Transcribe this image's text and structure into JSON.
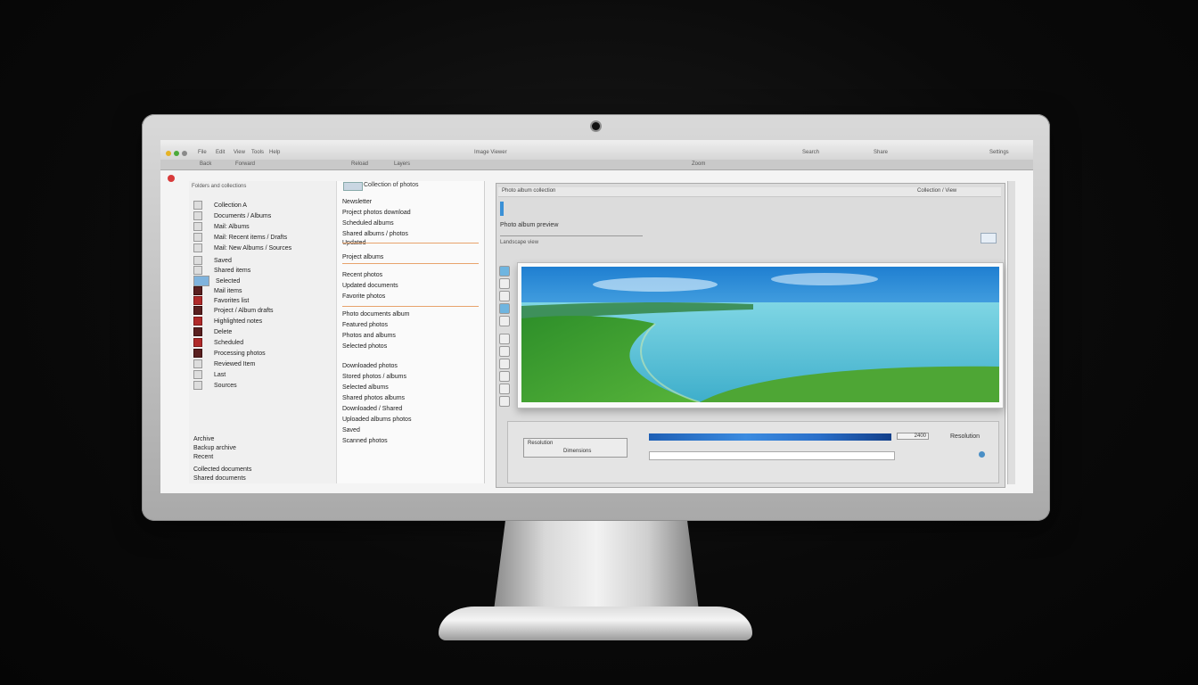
{
  "topbar": {
    "tabs": [
      "File",
      "Edit",
      "View",
      "Tools",
      "Help"
    ],
    "center_text": "Image Viewer",
    "right_items": [
      "Search",
      "Share",
      "Settings"
    ]
  },
  "toolbar": {
    "items": [
      "Back",
      "Forward",
      "Reload",
      "Layers",
      "Zoom"
    ]
  },
  "sidebar": {
    "header": "Folders and collections",
    "items": [
      {
        "label": "Collection A",
        "icon": "folder-icon"
      },
      {
        "label": "Documents / Albums",
        "icon": "folder-icon"
      },
      {
        "label": "Mail: Albums",
        "icon": "folder-icon"
      },
      {
        "label": "Mail: Recent items / Drafts",
        "icon": "folder-icon"
      },
      {
        "label": "Mail: New Albums / Sources",
        "icon": "folder-icon"
      },
      {
        "label": "Saved",
        "icon": "folder-icon"
      },
      {
        "label": "Shared items",
        "icon": "folder-icon"
      },
      {
        "label": "Selected",
        "icon": "image-icon"
      },
      {
        "label": "Mail items",
        "icon": "tag-icon"
      },
      {
        "label": "Favorites list",
        "icon": "tag-icon"
      },
      {
        "label": "Project / Album drafts",
        "icon": "tag-icon"
      },
      {
        "label": "Highlighted notes",
        "icon": "tag-icon"
      },
      {
        "label": "Delete",
        "icon": "tag-icon"
      },
      {
        "label": "Scheduled",
        "icon": "tag-icon"
      },
      {
        "label": "Processing photos",
        "icon": "tag-icon"
      },
      {
        "label": "Reviewed Item",
        "icon": "tag-icon"
      },
      {
        "label": "Last",
        "icon": "tag-icon"
      },
      {
        "label": "Sources",
        "icon": "tag-icon"
      }
    ],
    "footer_1": "Archive",
    "footer_2": "Backup archive",
    "footer_3": "Recent",
    "footer_4": "Collected documents",
    "footer_5": "Shared documents"
  },
  "messages": {
    "title": "Collection of photos",
    "rows": [
      "Newsletter",
      "Project photos download",
      "Scheduled albums",
      "Shared albums / photos",
      "Updated",
      "Project albums",
      "Recent photos",
      "Updated documents",
      "Favorite photos",
      "Photo documents album",
      "Featured photos",
      "Photos and albums",
      "Selected photos",
      "Downloaded photos",
      "Stored photos / albums",
      "Selected albums",
      "Shared photos albums",
      "Downloaded / Shared",
      "Uploaded albums photos",
      "Saved",
      "Scanned photos"
    ]
  },
  "content": {
    "header_left": "Photo album collection",
    "header_right": "Collection / View",
    "subtitle": "Photo album preview",
    "info": "Landscape view",
    "image_alt": "Landscape photo of green field and lake",
    "bottom_box_1": "Resolution",
    "bottom_box_2": "Dimensions",
    "counter": "2400",
    "status": "Resolution"
  },
  "colors": {
    "accent_blue": "#3a90d6",
    "progress_blue": "#2a6fc9",
    "record_red": "#d83a3a",
    "separator_orange": "#e8a36c"
  }
}
